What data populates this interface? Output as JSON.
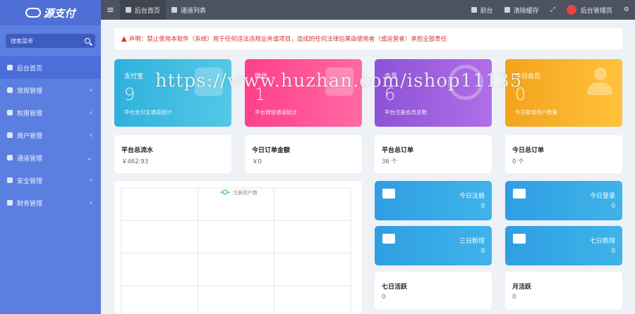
{
  "brand": {
    "name": "源支付"
  },
  "sidebar": {
    "search_placeholder": "搜索菜单",
    "items": [
      {
        "label": "后台首页",
        "chevron": ""
      },
      {
        "label": "常规管理",
        "chevron": "‹"
      },
      {
        "label": "权限管理",
        "chevron": "‹"
      },
      {
        "label": "商户管理",
        "chevron": "‹"
      },
      {
        "label": "通道管理",
        "chevron": "⌄"
      },
      {
        "label": "安全管理",
        "chevron": "‹"
      },
      {
        "label": "财务管理",
        "chevron": "‹"
      }
    ]
  },
  "topbar": {
    "menu_glyph": "≡",
    "tabs": [
      {
        "label": "后台首页"
      },
      {
        "label": "通道列表"
      }
    ],
    "front": "前台",
    "clear_cache": "清除缓存",
    "fullscreen_glyph": "⤢",
    "admin": "后台管理员",
    "settings_glyph": "⚙"
  },
  "notice": {
    "text": "声明：禁止使用本软件（系统）用于任何违法违规业务或项目，造成的任何法律后果由使用者（或运营者）承担全部责任"
  },
  "stat_cards": [
    {
      "title": "支付宝",
      "value": "9",
      "sub": "平台支付宝通道统计"
    },
    {
      "title": "微信",
      "value": "1",
      "sub": "平台微信通道统计"
    },
    {
      "title": "会员",
      "value": "6",
      "sub": "平台注册会员总数"
    },
    {
      "title": "今日会员",
      "value": "0",
      "sub": "今日新增用户数量"
    }
  ],
  "info_boxes": [
    {
      "title": "平台总流水",
      "value": "￥462.93"
    },
    {
      "title": "今日订单金额",
      "value": "￥0"
    },
    {
      "title": "平台总订单",
      "value": "36 个"
    },
    {
      "title": "今日总订单",
      "value": "0 个"
    }
  ],
  "small_cards": [
    {
      "title": "今日注册",
      "value": "0",
      "icon": "coffee-icon"
    },
    {
      "title": "今日登录",
      "value": "0",
      "icon": "truck-icon"
    },
    {
      "title": "三日新增",
      "value": "0",
      "icon": "cube-icon"
    },
    {
      "title": "七日新增",
      "value": "0",
      "icon": "cart-icon"
    }
  ],
  "bottom_boxes": [
    {
      "title": "七日活跃",
      "value": "0"
    },
    {
      "title": "月活跃",
      "value": "0"
    }
  ],
  "chart_data": {
    "type": "line",
    "title": "",
    "series": [
      {
        "name": "注册用户数",
        "values": []
      }
    ],
    "legend": "top-center",
    "grid": true,
    "color": "#3cb878"
  },
  "watermark": "https://www.huzhan.com/ishop11135",
  "colors": {
    "sidebar": "#5b7fe0",
    "topbar": "#4b5260",
    "alipay_card": "#2fb1dc",
    "wechat_card": "#ff3f8b",
    "member_card": "#8d52d6",
    "today_member_card": "#f3a31c",
    "small_card": "#2f9ee3",
    "notice_text": "#d2322d"
  }
}
